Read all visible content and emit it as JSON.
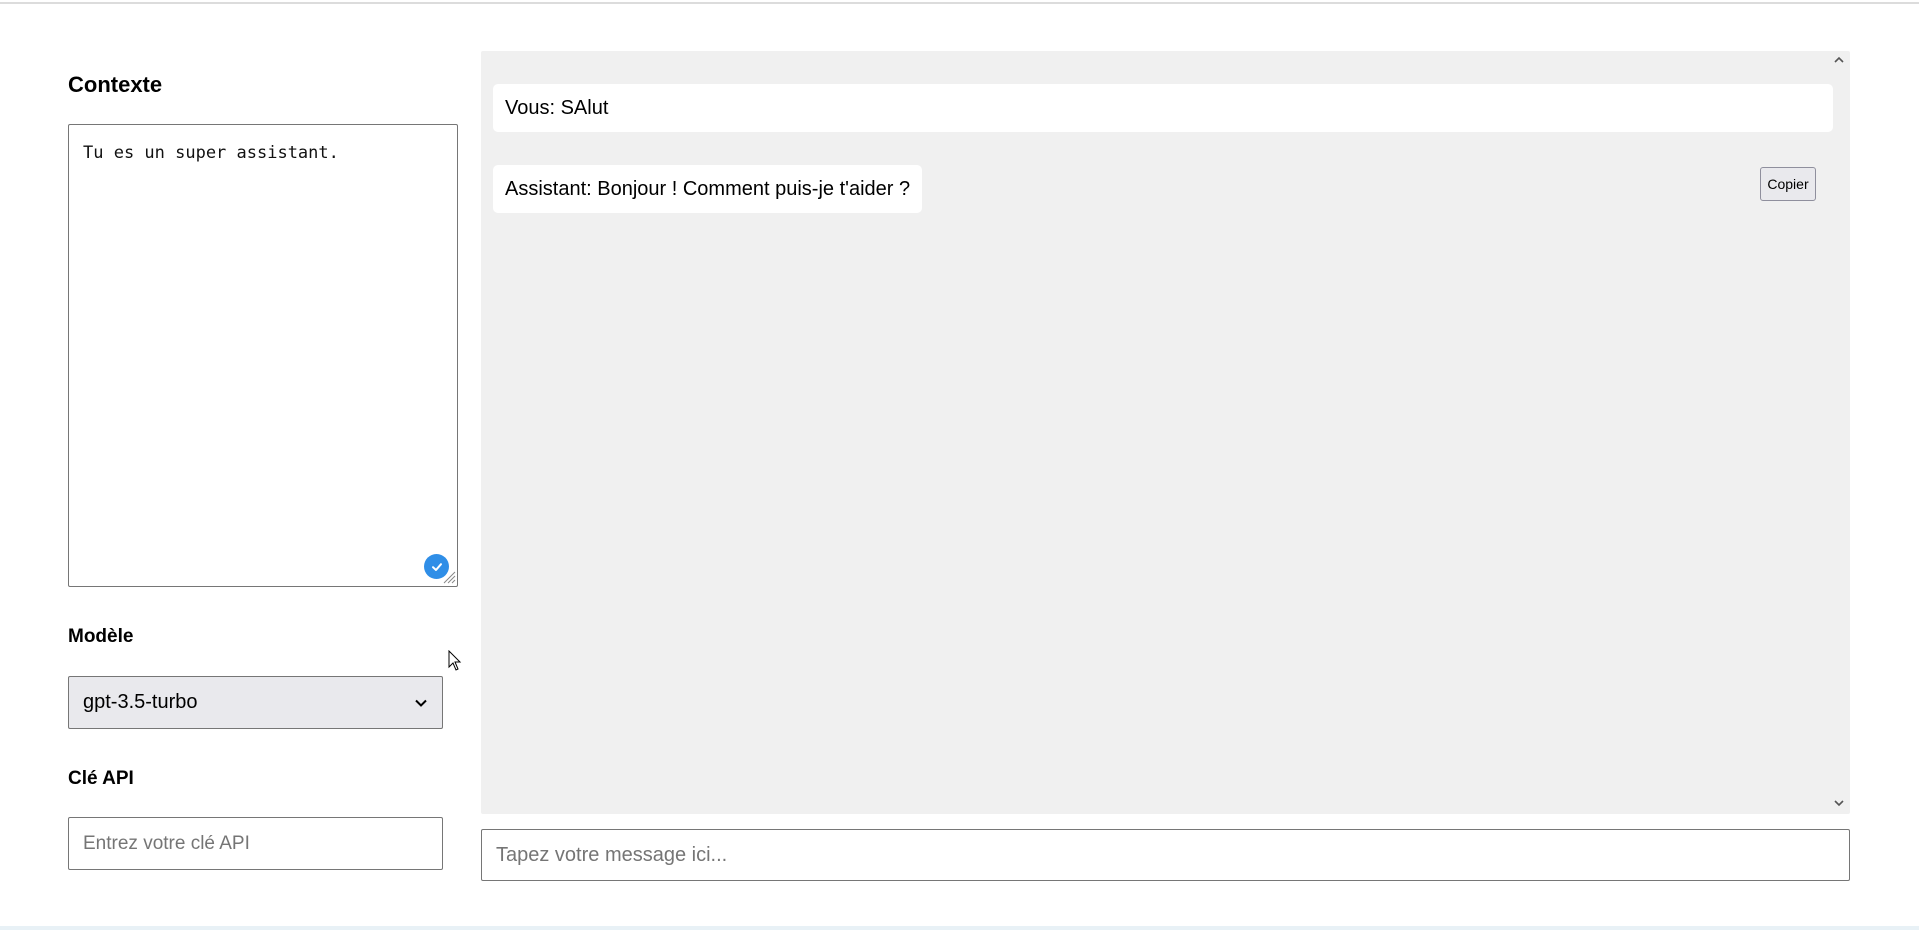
{
  "sidebar": {
    "context_title": "Contexte",
    "context_value": "Tu es un super assistant.",
    "model_title": "Modèle",
    "model_selected": "gpt-3.5-turbo",
    "api_title": "Clé API",
    "api_placeholder": "Entrez votre clé API"
  },
  "chat": {
    "messages": [
      {
        "role": "user",
        "text": "Vous: SAlut"
      },
      {
        "role": "assistant",
        "text": "Assistant: Bonjour ! Comment puis-je t'aider ?"
      }
    ],
    "copy_label": "Copier",
    "input_placeholder": "Tapez votre message ici..."
  },
  "icons": {
    "check": "check-circle-icon",
    "dropdown": "chevron-down-icon",
    "scroll_up": "chevron-up-icon",
    "scroll_down": "chevron-down-icon"
  },
  "colors": {
    "check_badge": "#2f8ee7",
    "chat_background": "#f0f0f0",
    "select_background": "#e9e9ed"
  }
}
